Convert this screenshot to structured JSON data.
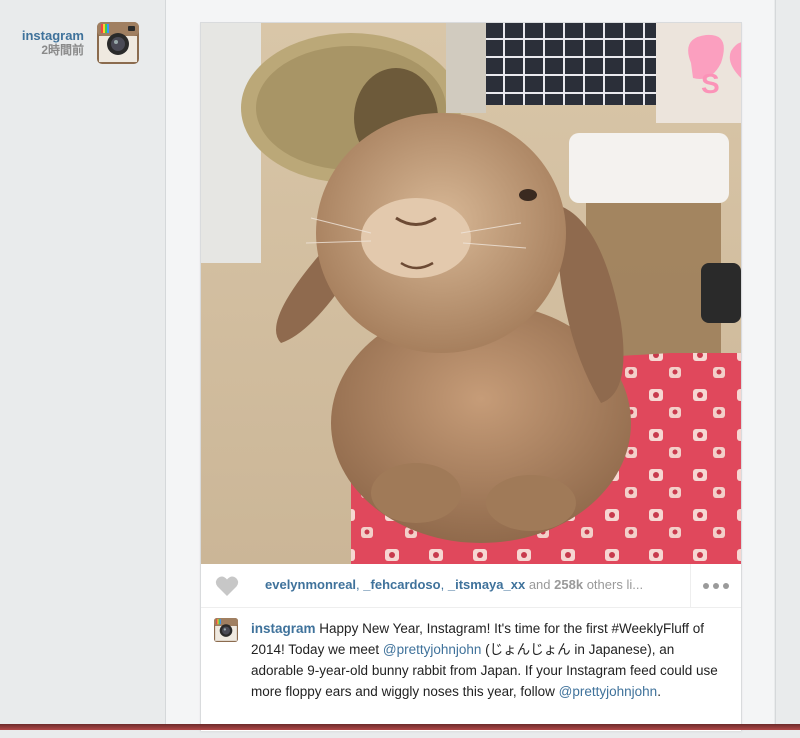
{
  "post": {
    "author": {
      "username": "instagram",
      "timestamp": "2時間前",
      "avatar_icon": "instagram-camera-icon"
    },
    "photo": {
      "overlay_text": "S"
    },
    "likes": {
      "heart_icon": "heart-icon",
      "likers": [
        "evelynmonreal",
        "_fehcardoso",
        "_itsmaya_xx"
      ],
      "separator": ",",
      "and_text": "and",
      "count": "258k",
      "others_text": "others li...",
      "more_icon": "more-options-icon"
    },
    "caption": {
      "username": "instagram",
      "part1": "Happy New Year, Instagram! It's time for the first #WeeklyFluff of 2014! Today we meet",
      "mention1": "@prettyjohnjohn",
      "part2": "(じょんじょん in Japanese), an adorable 9-year-old bunny rabbit from Japan. If your Instagram feed could use more floppy ears and wiggly noses this year, follow",
      "mention2": "@prettyjohnjohn",
      "part3": "."
    }
  },
  "colors": {
    "link": "#3f729b",
    "page_bg": "#e9ebec",
    "card_bg": "#ffffff",
    "muted": "#999999"
  }
}
